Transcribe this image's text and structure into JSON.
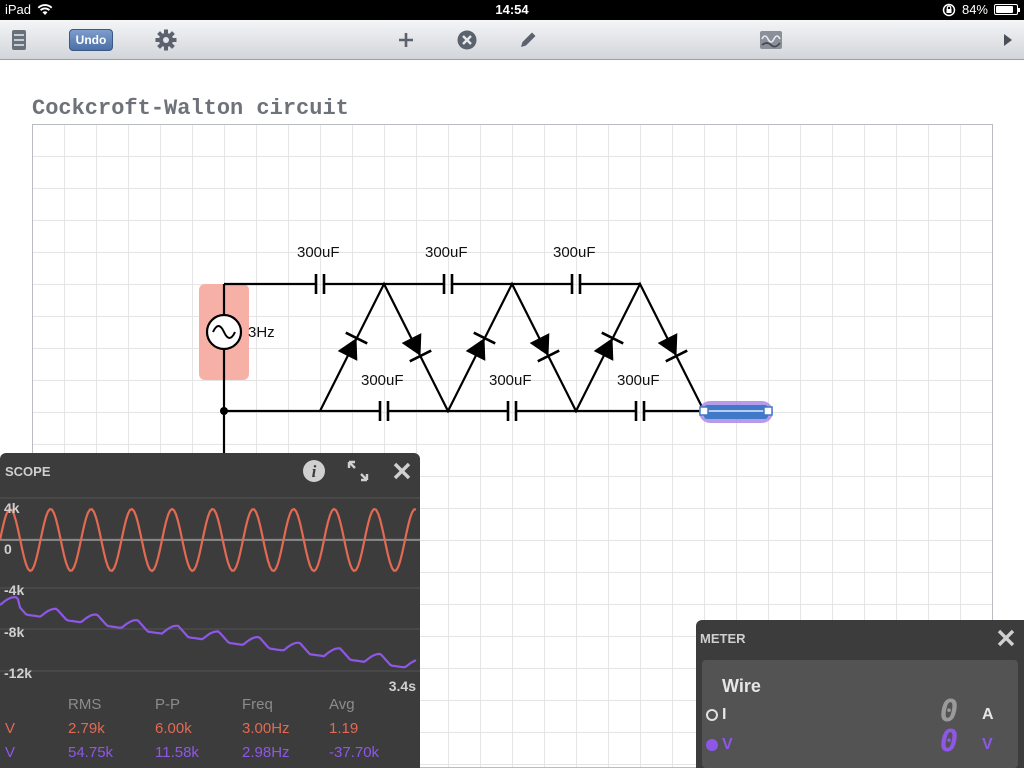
{
  "status_bar": {
    "device": "iPad",
    "time": "14:54",
    "battery": "84%",
    "battery_level": 0.84
  },
  "toolbar": {
    "undo_label": "Undo",
    "icons": [
      "file-list-icon",
      "gear-icon",
      "plus-icon",
      "close-circle-icon",
      "pencil-icon",
      "scope-toggle-icon",
      "play-arrow-icon"
    ]
  },
  "canvas": {
    "title": "Cockcroft-Walton circuit"
  },
  "circuit": {
    "source_label": "3Hz",
    "top_capacitors": [
      "300uF",
      "300uF",
      "300uF"
    ],
    "bottom_capacitors": [
      "300uF",
      "300uF",
      "300uF"
    ],
    "colors": {
      "source_highlight": "#f6b0a6",
      "wire_selected": "#3f79c7",
      "wire_glow": "#a98ae8"
    }
  },
  "scope": {
    "title": "SCOPE",
    "y_labels": [
      "4k",
      "0",
      "-4k",
      "-8k",
      "-12k"
    ],
    "time_label": "3.4s",
    "headers": [
      "RMS",
      "P-P",
      "Freq",
      "Avg"
    ],
    "rows": [
      {
        "name": "V",
        "color": "#e26a52",
        "values": [
          "2.79k",
          "6.00k",
          "3.00Hz",
          "1.19"
        ]
      },
      {
        "name": "V",
        "color": "#8e57e6",
        "values": [
          "54.75k",
          "11.58k",
          "2.98Hz",
          "-37.70k"
        ]
      }
    ]
  },
  "meter": {
    "title": "METER",
    "component": "Wire",
    "rows": [
      {
        "label": "I",
        "value": "0",
        "unit": "A",
        "selected": false
      },
      {
        "label": "V",
        "value": "0",
        "unit": "V",
        "selected": true
      }
    ]
  }
}
